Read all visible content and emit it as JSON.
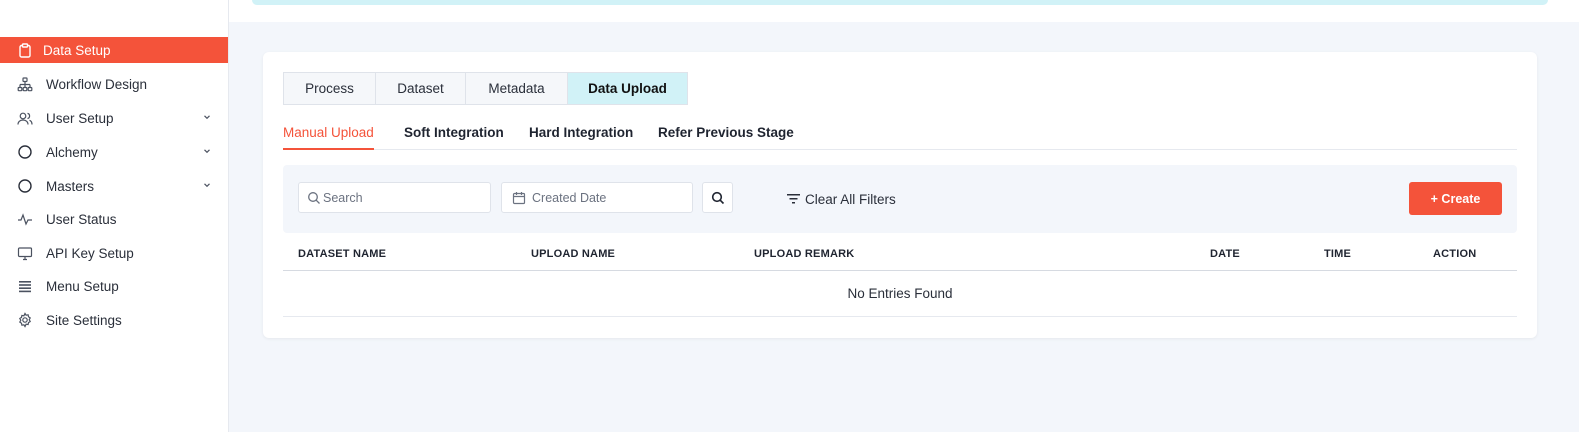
{
  "sidebar": {
    "items": [
      {
        "label": "Data Setup",
        "icon": "clipboard-icon",
        "active": true,
        "has_chevron": false
      },
      {
        "label": "Workflow Design",
        "icon": "sitemap-icon",
        "active": false,
        "has_chevron": false
      },
      {
        "label": "User Setup",
        "icon": "users-icon",
        "active": false,
        "has_chevron": true
      },
      {
        "label": "Alchemy",
        "icon": "circle-icon",
        "active": false,
        "has_chevron": true
      },
      {
        "label": "Masters",
        "icon": "circle-icon",
        "active": false,
        "has_chevron": true
      },
      {
        "label": "User Status",
        "icon": "activity-icon",
        "active": false,
        "has_chevron": false
      },
      {
        "label": "API Key Setup",
        "icon": "monitor-icon",
        "active": false,
        "has_chevron": false
      },
      {
        "label": "Menu Setup",
        "icon": "list-icon",
        "active": false,
        "has_chevron": false
      },
      {
        "label": "Site Settings",
        "icon": "gear-icon",
        "active": false,
        "has_chevron": false
      }
    ]
  },
  "tabs": [
    "Process",
    "Dataset",
    "Metadata",
    "Data Upload"
  ],
  "active_tab": "Data Upload",
  "subtabs": [
    "Manual Upload",
    "Soft Integration",
    "Hard Integration",
    "Refer Previous Stage"
  ],
  "active_subtab": "Manual Upload",
  "filters": {
    "search_placeholder": "Search",
    "date_placeholder": "Created Date",
    "clear_label": "Clear All Filters",
    "create_label": "+ Create"
  },
  "table": {
    "columns": [
      "DATASET NAME",
      "UPLOAD NAME",
      "UPLOAD REMARK",
      "DATE",
      "TIME",
      "ACTION"
    ],
    "empty_message": "No Entries Found"
  },
  "colors": {
    "accent": "#f4533a",
    "active_tab_bg": "#d1f2f7",
    "page_bg": "#f3f6fb"
  }
}
